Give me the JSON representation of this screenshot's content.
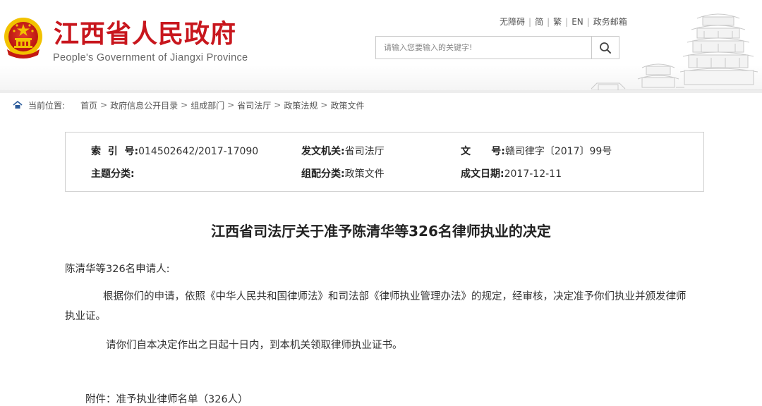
{
  "header": {
    "title": "江西省人民政府",
    "subtitle": "People's Government of Jiangxi Province",
    "top_links": [
      "无障碍",
      "简",
      "繁",
      "EN",
      "政务邮箱"
    ],
    "search": {
      "placeholder": "请输入您要输入的关键字!"
    }
  },
  "breadcrumb": {
    "prefix": "当前位置:",
    "items": [
      "首页",
      "政府信息公开目录",
      "组成部门",
      "省司法厅",
      "政策法规",
      "政策文件"
    ]
  },
  "meta": {
    "index_no_label": "索  引  号:",
    "index_no_value": "014502642/2017-17090",
    "issuer_label": "发文机关:",
    "issuer_value": "省司法厅",
    "doc_no_label": "文      号:",
    "doc_no_value": "赣司律字〔2017〕99号",
    "topic_label": "主题分类:",
    "topic_value": "",
    "category_label": "组配分类:",
    "category_value": "政策文件",
    "date_label": "成文日期:",
    "date_value": "2017-12-11"
  },
  "document": {
    "title": "江西省司法厅关于准予陈清华等326名律师执业的决定",
    "salutation": "陈清华等326名申请人:",
    "para1_line1": "根据你们的申请，依照《中华人民共和国律师法》和司法部《律师执业管理办法》的规定，经审核，决定准予你们执业并颁发律师",
    "para1_line2": "执业证。",
    "para2": "请你们自本决定作出之日起十日内，到本机关领取律师执业证书。",
    "attachment": "附件：准予执业律师名单（326人）"
  },
  "colors": {
    "brand_red": "#c8161d",
    "emblem_gold": "#f2c200"
  }
}
